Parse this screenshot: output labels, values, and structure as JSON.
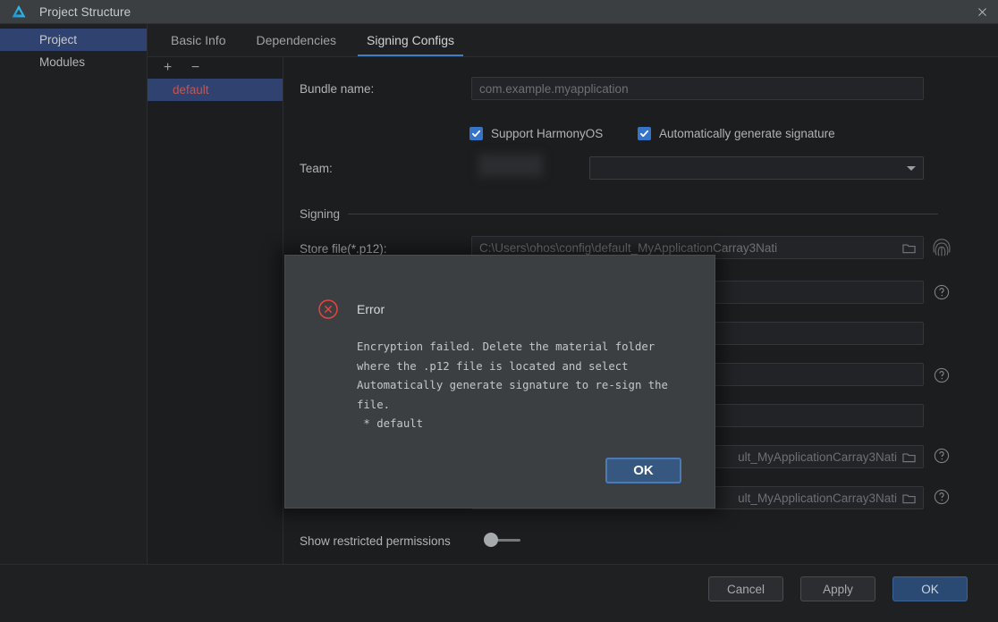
{
  "window": {
    "title": "Project Structure",
    "logo_icon": "huawei-devstudio-logo-icon",
    "close_icon": "close-icon"
  },
  "sidebar": {
    "items": [
      {
        "label": "Project",
        "selected": true
      },
      {
        "label": "Modules",
        "selected": false
      }
    ]
  },
  "tabs": [
    {
      "label": "Basic Info",
      "active": false
    },
    {
      "label": "Dependencies",
      "active": false
    },
    {
      "label": "Signing Configs",
      "active": true
    }
  ],
  "configs_panel": {
    "add_label": "+",
    "remove_label": "−",
    "items": [
      {
        "label": "default",
        "selected": true
      }
    ]
  },
  "form": {
    "bundle_name": {
      "label": "Bundle name:",
      "value": "com.example.myapplication",
      "placeholder": "com.example.myapplication"
    },
    "support_harmonyos": {
      "label": "Support HarmonyOS",
      "checked": true
    },
    "auto_generate_signature": {
      "label": "Automatically generate signature",
      "checked": true
    },
    "team": {
      "label": "Team:",
      "value": "",
      "selected_option": ""
    },
    "signing_section": {
      "label": "Signing"
    },
    "store_file": {
      "label": "Store file(*.p12):",
      "value": "C:\\Users\\ohos\\config\\default_MyApplicationCarray3Nati",
      "folder_icon": "folder-icon",
      "trailing_icon": "fingerprint-icon"
    },
    "row_2": {
      "value": "",
      "help_icon": "help-circle-icon"
    },
    "row_3": {
      "value": ""
    },
    "row_4": {
      "value": "",
      "help_icon": "help-circle-icon"
    },
    "row_5": {
      "value": ""
    },
    "row_6": {
      "value": "ult_MyApplicationCarray3Nati",
      "folder_icon": "folder-icon",
      "help_icon": "help-circle-icon"
    },
    "row_7": {
      "value": "ult_MyApplicationCarray3Nati",
      "folder_icon": "folder-icon",
      "help_icon": "help-circle-icon"
    },
    "show_restricted_permissions": {
      "label": "Show restricted permissions",
      "enabled": false
    }
  },
  "footer": {
    "cancel_label": "Cancel",
    "apply_label": "Apply",
    "ok_label": "OK"
  },
  "dialog": {
    "icon": "error-circle-icon",
    "title": "Error",
    "message": "Encryption failed. Delete the material folder\nwhere the .p12 file is located and select\nAutomatically generate signature to re-sign the\nfile.\n * default",
    "ok_label": "OK"
  },
  "colors": {
    "accent_blue": "#3d7ec4",
    "selection_blue": "#2f4270",
    "error_red": "#e8433f",
    "config_item_text": "#c75450",
    "checkbox_blue": "#3574c8",
    "dialog_bg": "#3c3f41",
    "window_bg": "#1c1d1f"
  }
}
